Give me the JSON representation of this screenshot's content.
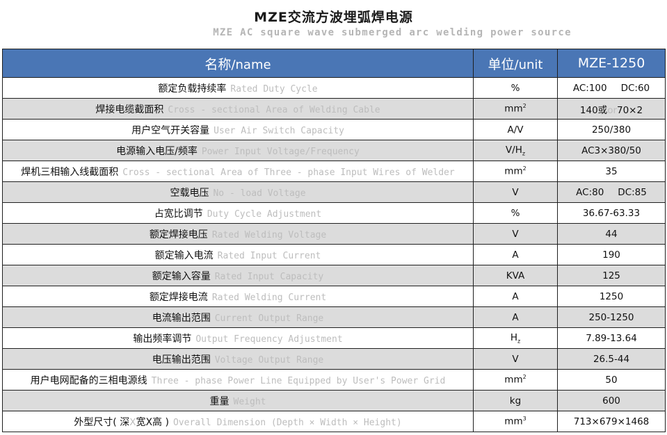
{
  "title": "MZE交流方波埋弧焊电源",
  "subtitle": "MZE AC square wave submerged arc welding power source",
  "header": {
    "name_cn": "名称",
    "name_en": "/name",
    "unit_cn": "单位",
    "unit_en": "/unit",
    "model": "MZE-1250"
  },
  "colors": {
    "header_bg": "#4a76b5",
    "shaded_row": "#dcdcdc",
    "english_text": "#bdbdbd"
  },
  "rows": [
    {
      "cn": "额定负载持续率",
      "en": "Rated Duty Cycle",
      "unit": "%",
      "value_a": "AC:100",
      "value_b": "DC:60"
    },
    {
      "cn": "焊接电缆截面积",
      "en": "Cross - sectional Area of Welding Cable",
      "unit": "mm",
      "unit_sup": "2",
      "value_a": "140或",
      "value_or": "or",
      "value_b": "70×2"
    },
    {
      "cn": "用户空气开关容量",
      "en": "User Air Switch Capacity",
      "unit": "A/V",
      "value": "250/380"
    },
    {
      "cn": "电源输入电压/频率",
      "en": "Power Input Voltage/Frequency",
      "unit": "V/H",
      "unit_sub": "z",
      "value": "AC3×380/50"
    },
    {
      "cn": "焊机三相输入线截面积",
      "en": "Cross - sectional Area of Three - phase Input Wires of Welder",
      "unit": "mm",
      "unit_sup": "2",
      "value": "35"
    },
    {
      "cn": "空载电压",
      "en": "No - load Voltage",
      "unit": "V",
      "value_a": "AC:80",
      "value_b": "DC:85"
    },
    {
      "cn": "占宽比调节",
      "en": "Duty Cycle Adjustment",
      "unit": "%",
      "value": "36.67-63.33"
    },
    {
      "cn": "额定焊接电压",
      "en": "Rated Welding Voltage",
      "unit": "V",
      "value": "44"
    },
    {
      "cn": "额定输入电流",
      "en": "Rated Input Current",
      "unit": "A",
      "value": "190"
    },
    {
      "cn": "额定输入容量",
      "en": "Rated Input Capacity",
      "unit": "KVA",
      "value": "125"
    },
    {
      "cn": "额定焊接电流",
      "en": "Rated Welding Current",
      "unit": "A",
      "value": "1250"
    },
    {
      "cn": "电流输出范围",
      "en": "Current Output Range",
      "unit": "A",
      "value": "250-1250"
    },
    {
      "cn": "输出频率调节",
      "en": "Output Frequency Adjustment",
      "unit": "H",
      "unit_sub": "z",
      "value": "7.89-13.64"
    },
    {
      "cn": "电压输出范围",
      "en": "Voltage Output Range",
      "unit": "V",
      "value": "26.5-44"
    },
    {
      "cn": "用户电网配备的三相电源线",
      "en": "Three - phase Power Line Equipped by User's Power Grid",
      "unit": "mm",
      "unit_sup": "2",
      "value": "50"
    },
    {
      "cn": "重量",
      "en": "Weight",
      "unit": "kg",
      "value": "600"
    },
    {
      "cn": "外型尺寸( 深",
      "cn_x": "X",
      "cn_b": "宽X高 )",
      "en": "Overall Dimension (Depth × Width × Height)",
      "unit": "mm",
      "unit_sup": "3",
      "value": "713×679×1468"
    }
  ]
}
